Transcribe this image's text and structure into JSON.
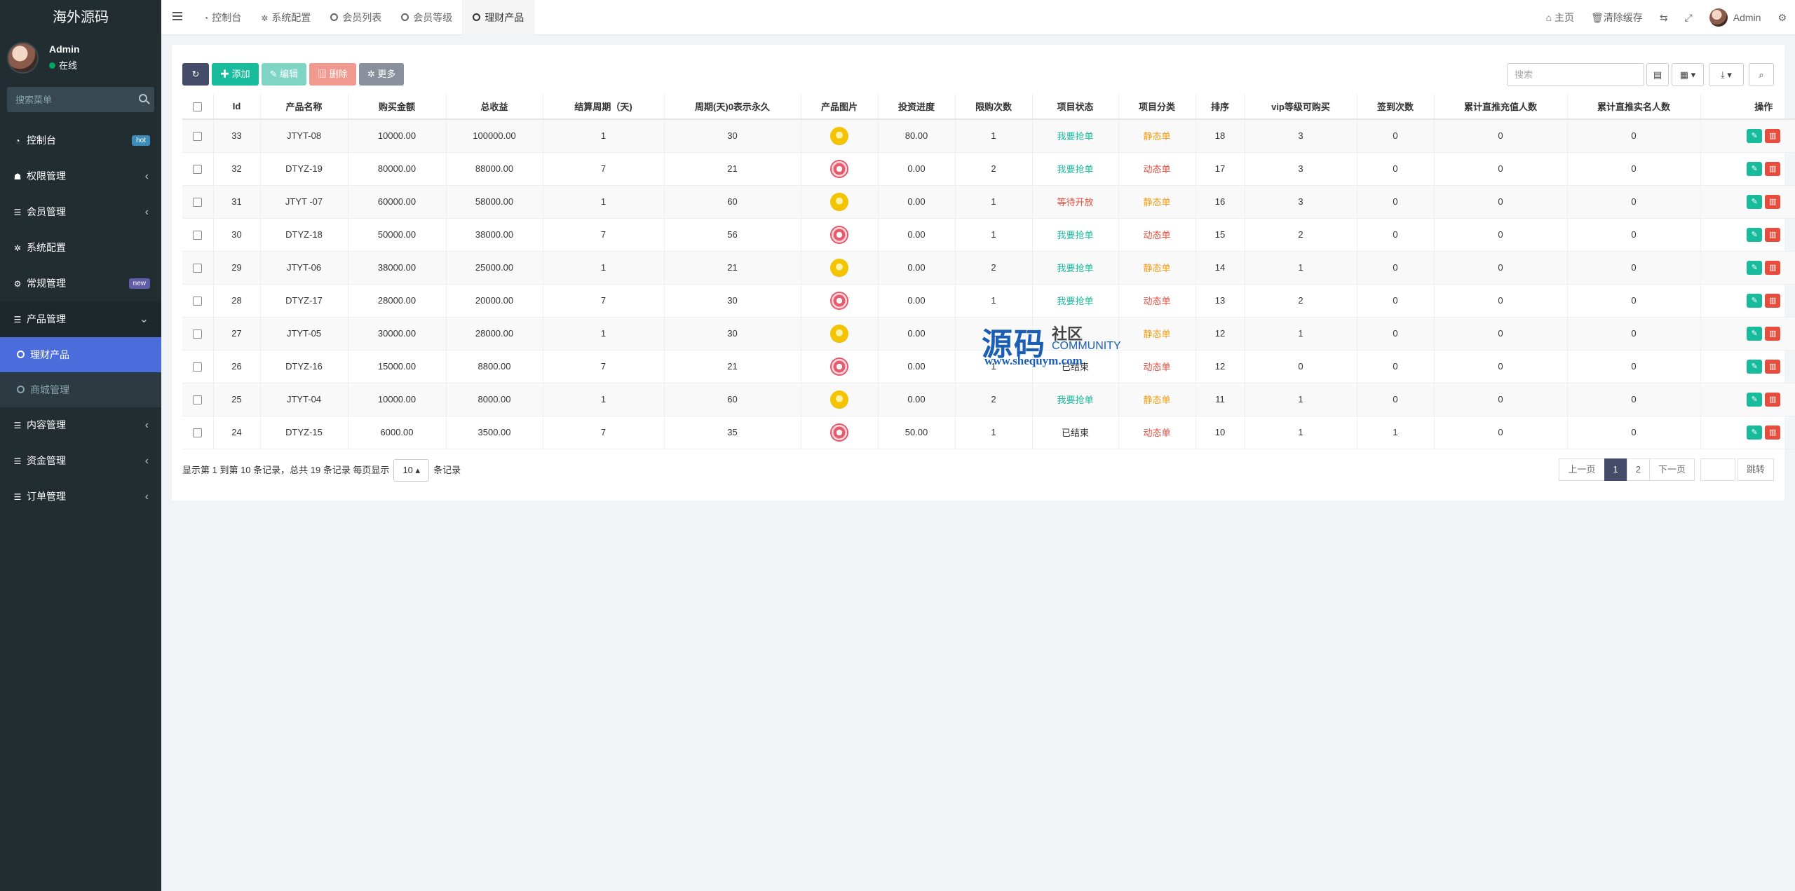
{
  "app": {
    "logo": "海外源码"
  },
  "user": {
    "name": "Admin",
    "status": "在线"
  },
  "sidebar": {
    "search_placeholder": "搜索菜单",
    "items": [
      {
        "label": "控制台",
        "badge": "hot"
      },
      {
        "label": "权限管理"
      },
      {
        "label": "会员管理"
      },
      {
        "label": "系统配置"
      },
      {
        "label": "常规管理",
        "badge": "new"
      },
      {
        "label": "产品管理"
      },
      {
        "label": "内容管理"
      },
      {
        "label": "资金管理"
      },
      {
        "label": "订单管理"
      }
    ],
    "sub_items": [
      {
        "label": "理财产品"
      },
      {
        "label": "商城管理"
      }
    ]
  },
  "navbar": {
    "tabs": [
      {
        "label": "控制台"
      },
      {
        "label": "系统配置"
      },
      {
        "label": "会员列表"
      },
      {
        "label": "会员等级"
      },
      {
        "label": "理财产品"
      }
    ],
    "home": "主页",
    "clear_cache": "清除缓存",
    "admin": "Admin"
  },
  "toolbar": {
    "add": "添加",
    "edit": "编辑",
    "delete": "删除",
    "more": "更多",
    "search_placeholder": "搜索"
  },
  "table": {
    "headers": [
      "Id",
      "产品名称",
      "购买金额",
      "总收益",
      "结算周期（天)",
      "周期(天)0表示永久",
      "产品图片",
      "投资进度",
      "限购次数",
      "项目状态",
      "项目分类",
      "排序",
      "vip等级可购买",
      "签到次数",
      "累计直推充值人数",
      "累计直推实名人数",
      "操作"
    ],
    "rows": [
      {
        "id": "33",
        "name": "JTYT-08",
        "amount": "10000.00",
        "income": "100000.00",
        "settle": "1",
        "period": "30",
        "img": "gold",
        "progress": "80.00",
        "limit": "1",
        "status": "我要抢单",
        "status_type": "green",
        "category": "静态单",
        "cat_type": "static",
        "sort": "18",
        "vip": "3",
        "sign": "0",
        "recharge": "0",
        "realname": "0"
      },
      {
        "id": "32",
        "name": "DTYZ-19",
        "amount": "80000.00",
        "income": "88000.00",
        "settle": "7",
        "period": "21",
        "img": "pink",
        "progress": "0.00",
        "limit": "2",
        "status": "我要抢单",
        "status_type": "green",
        "category": "动态单",
        "cat_type": "dynamic",
        "sort": "17",
        "vip": "3",
        "sign": "0",
        "recharge": "0",
        "realname": "0"
      },
      {
        "id": "31",
        "name": "JTYT -07",
        "amount": "60000.00",
        "income": "58000.00",
        "settle": "1",
        "period": "60",
        "img": "gold",
        "progress": "0.00",
        "limit": "1",
        "status": "等待开放",
        "status_type": "red",
        "category": "静态单",
        "cat_type": "static",
        "sort": "16",
        "vip": "3",
        "sign": "0",
        "recharge": "0",
        "realname": "0"
      },
      {
        "id": "30",
        "name": "DTYZ-18",
        "amount": "50000.00",
        "income": "38000.00",
        "settle": "7",
        "period": "56",
        "img": "pink",
        "progress": "0.00",
        "limit": "1",
        "status": "我要抢单",
        "status_type": "green",
        "category": "动态单",
        "cat_type": "dynamic",
        "sort": "15",
        "vip": "2",
        "sign": "0",
        "recharge": "0",
        "realname": "0"
      },
      {
        "id": "29",
        "name": "JTYT-06",
        "amount": "38000.00",
        "income": "25000.00",
        "settle": "1",
        "period": "21",
        "img": "gold",
        "progress": "0.00",
        "limit": "2",
        "status": "我要抢单",
        "status_type": "green",
        "category": "静态单",
        "cat_type": "static",
        "sort": "14",
        "vip": "1",
        "sign": "0",
        "recharge": "0",
        "realname": "0"
      },
      {
        "id": "28",
        "name": "DTYZ-17",
        "amount": "28000.00",
        "income": "20000.00",
        "settle": "7",
        "period": "30",
        "img": "pink",
        "progress": "0.00",
        "limit": "1",
        "status": "我要抢单",
        "status_type": "green",
        "category": "动态单",
        "cat_type": "dynamic",
        "sort": "13",
        "vip": "2",
        "sign": "0",
        "recharge": "0",
        "realname": "0"
      },
      {
        "id": "27",
        "name": "JTYT-05",
        "amount": "30000.00",
        "income": "28000.00",
        "settle": "1",
        "period": "30",
        "img": "gold",
        "progress": "0.00",
        "limit": "1",
        "status": "",
        "status_type": "green",
        "category": "静态单",
        "cat_type": "static",
        "sort": "12",
        "vip": "1",
        "sign": "0",
        "recharge": "0",
        "realname": "0"
      },
      {
        "id": "26",
        "name": "DTYZ-16",
        "amount": "15000.00",
        "income": "8800.00",
        "settle": "7",
        "period": "21",
        "img": "pink",
        "progress": "0.00",
        "limit": "1",
        "status": "已结束",
        "status_type": "plain",
        "category": "动态单",
        "cat_type": "dynamic",
        "sort": "12",
        "vip": "0",
        "sign": "0",
        "recharge": "0",
        "realname": "0"
      },
      {
        "id": "25",
        "name": "JTYT-04",
        "amount": "10000.00",
        "income": "8000.00",
        "settle": "1",
        "period": "60",
        "img": "gold",
        "progress": "0.00",
        "limit": "2",
        "status": "我要抢单",
        "status_type": "green",
        "category": "静态单",
        "cat_type": "static",
        "sort": "11",
        "vip": "1",
        "sign": "0",
        "recharge": "0",
        "realname": "0"
      },
      {
        "id": "24",
        "name": "DTYZ-15",
        "amount": "6000.00",
        "income": "3500.00",
        "settle": "7",
        "period": "35",
        "img": "pink",
        "progress": "50.00",
        "limit": "1",
        "status": "已结束",
        "status_type": "plain",
        "category": "动态单",
        "cat_type": "dynamic",
        "sort": "10",
        "vip": "1",
        "sign": "1",
        "recharge": "0",
        "realname": "0"
      }
    ]
  },
  "footer": {
    "info_prefix": "显示第 1 到第 10 条记录，总共 19 条记录 每页显示",
    "page_size": "10",
    "info_suffix": "条记录"
  },
  "pager": {
    "prev": "上一页",
    "pages": [
      "1",
      "2"
    ],
    "next": "下一页",
    "jump": "跳转"
  },
  "watermark": {
    "big": "源码",
    "she": "社区",
    "community": "COMMUNITY",
    "url": "www.shequym.com"
  }
}
